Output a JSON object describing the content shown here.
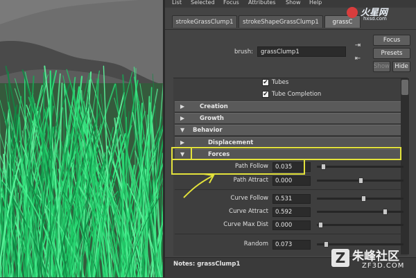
{
  "menubar": {
    "items": [
      "List",
      "Selected",
      "Focus",
      "Attributes",
      "Show",
      "Help"
    ]
  },
  "tabs": [
    "strokeGrassClump1",
    "strokeShapeGrassClump1",
    "grassC"
  ],
  "brush": {
    "label": "brush:",
    "value": "grassClump1"
  },
  "buttons": {
    "focus": "Focus",
    "presets": "Presets",
    "show": "Show",
    "hide": "Hide"
  },
  "checks": [
    {
      "label": "Tubes",
      "checked": true
    },
    {
      "label": "Tube Completion",
      "checked": true
    }
  ],
  "sections": {
    "creation": "Creation",
    "growth": "Growth",
    "behavior": "Behavior",
    "displacement": "Displacement",
    "forces": "Forces"
  },
  "attributes": [
    {
      "label": "Path Follow",
      "value": "0.035",
      "slider": 0.035
    },
    {
      "label": "Path Attract",
      "value": "0.000",
      "slider": 0.5
    },
    {
      "label": "Curve Follow",
      "value": "0.531",
      "slider": 0.531
    },
    {
      "label": "Curve Attract",
      "value": "0.592",
      "slider": 0.8
    },
    {
      "label": "Curve Max Dist",
      "value": "0.000",
      "slider": 0.0
    },
    {
      "label": "Random",
      "value": "0.073",
      "slider": 0.073
    }
  ],
  "notes": {
    "label": "Notes:",
    "value": "grassClump1"
  },
  "watermark_top": {
    "name": "火星网",
    "url": "hxsd.com"
  },
  "watermark_bottom": {
    "glyph": "Z",
    "name": "朱峰社区",
    "url": "ZF3D.COM"
  },
  "colors": {
    "highlight": "#e3e23b",
    "grass": "#2ee07a",
    "panel": "#444444"
  }
}
